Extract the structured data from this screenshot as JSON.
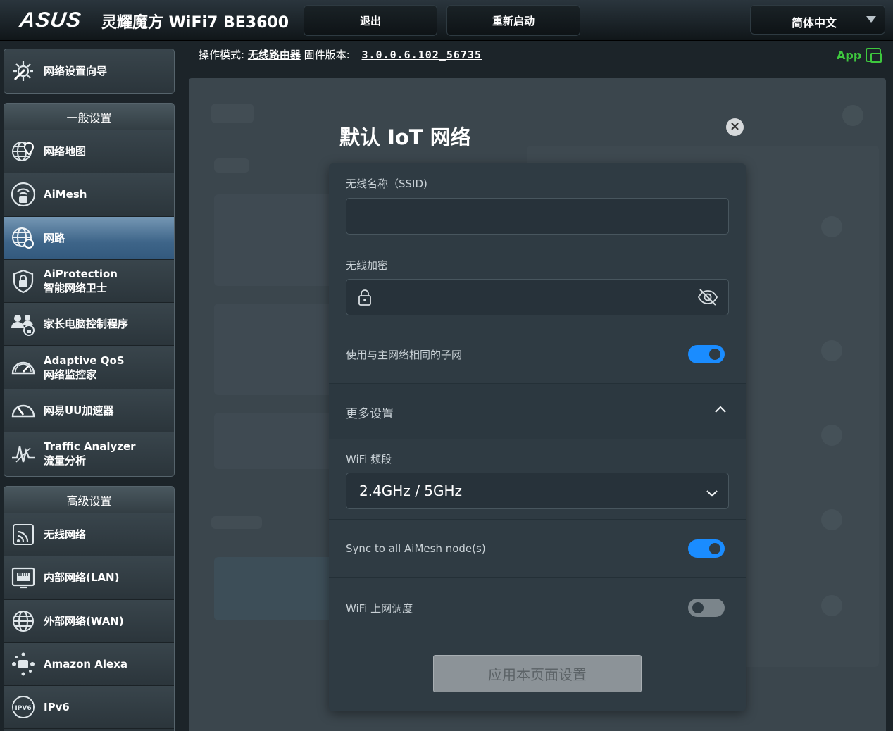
{
  "header": {
    "logo": "ASUS",
    "model": "灵耀魔方 WiFi7 BE3600",
    "logout_label": "退出",
    "reboot_label": "重新启动",
    "language": "简体中文"
  },
  "status": {
    "mode_label": "操作模式:",
    "mode_value": "无线路由器",
    "fw_label": "固件版本:",
    "fw_value": "3.0.0.6.102_56735",
    "app_label": "App"
  },
  "sidebar": {
    "wizard": {
      "label": "网络设置向导",
      "icon": "wizard-icon"
    },
    "general_title": "一般设置",
    "general_items": [
      {
        "label": "网络地图",
        "label2": "",
        "icon": "network-map-icon"
      },
      {
        "label": "AiMesh",
        "label2": "",
        "icon": "aimesh-icon"
      },
      {
        "label": "网路",
        "label2": "",
        "icon": "network-globe-icon"
      },
      {
        "label": "AiProtection",
        "label2": "智能网络卫士",
        "icon": "shield-lock-icon"
      },
      {
        "label": "家长电脑控制程序",
        "label2": "",
        "icon": "parental-control-icon"
      },
      {
        "label": "Adaptive QoS",
        "label2": "网络监控家",
        "icon": "gauge-icon"
      },
      {
        "label": "网易UU加速器",
        "label2": "",
        "icon": "speedometer-icon"
      },
      {
        "label": "Traffic Analyzer",
        "label2": "流量分析",
        "icon": "traffic-analyzer-icon"
      }
    ],
    "advanced_title": "高级设置",
    "advanced_items": [
      {
        "label": "无线网络",
        "label2": "",
        "icon": "wireless-icon"
      },
      {
        "label": "内部网络(LAN)",
        "label2": "",
        "icon": "lan-icon"
      },
      {
        "label": "外部网络(WAN)",
        "label2": "",
        "icon": "wan-globe-icon"
      },
      {
        "label": "Amazon Alexa",
        "label2": "",
        "icon": "alexa-icon"
      },
      {
        "label": "IPv6",
        "label2": "",
        "icon": "ipv6-icon"
      }
    ]
  },
  "modal": {
    "title": "默认 IoT 网络",
    "ssid_label": "无线名称（SSID)",
    "ssid_value": "",
    "password_label": "无线加密",
    "password_value": "",
    "same_subnet_label": "使用与主网络相同的子网",
    "same_subnet_on": true,
    "more_settings_label": "更多设置",
    "band_label": "WiFi 频段",
    "band_value": "2.4GHz / 5GHz",
    "sync_label": "Sync to all AiMesh node(s)",
    "sync_on": true,
    "schedule_label": "WiFi 上网调度",
    "schedule_on": false,
    "apply_label": "应用本页面设置"
  },
  "colors": {
    "accent": "#1a8cff",
    "active_nav": "#3e6589",
    "app_green": "#3ec83e"
  }
}
